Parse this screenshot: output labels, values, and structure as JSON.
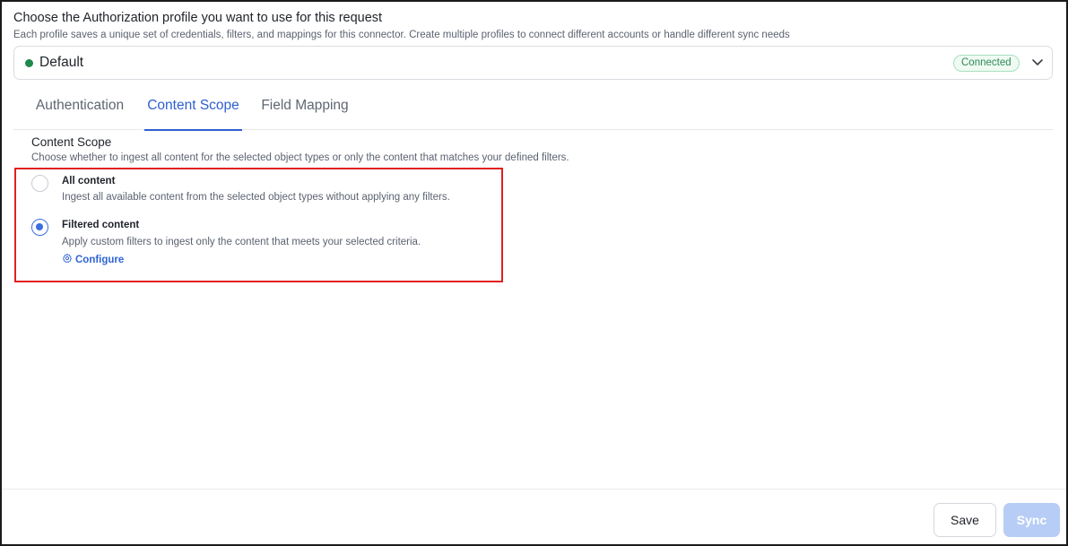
{
  "header": {
    "title": "Choose the Authorization profile you want to use for this request",
    "subtitle": "Each profile saves a unique set of credentials, filters, and mappings for this connector. Create multiple profiles to connect different accounts or handle different sync needs"
  },
  "profile": {
    "name": "Default",
    "status": "Connected",
    "status_color": "#1f8a4c"
  },
  "tabs": [
    {
      "label": "Authentication",
      "active": false
    },
    {
      "label": "Content Scope",
      "active": true
    },
    {
      "label": "Field Mapping",
      "active": false
    }
  ],
  "content_scope": {
    "title": "Content Scope",
    "description": "Choose whether to ingest all content for the selected object types or only the content that matches your defined filters.",
    "options": [
      {
        "label": "All content",
        "description": "Ingest all available content from the selected object types without applying any filters.",
        "selected": false
      },
      {
        "label": "Filtered content",
        "description": "Apply custom filters to ingest only the content that meets your selected criteria.",
        "selected": true
      }
    ],
    "configure_label": "Configure"
  },
  "footer": {
    "save_label": "Save",
    "sync_label": "Sync"
  },
  "colors": {
    "accent": "#2f5fd0",
    "highlight": "#e02020"
  }
}
